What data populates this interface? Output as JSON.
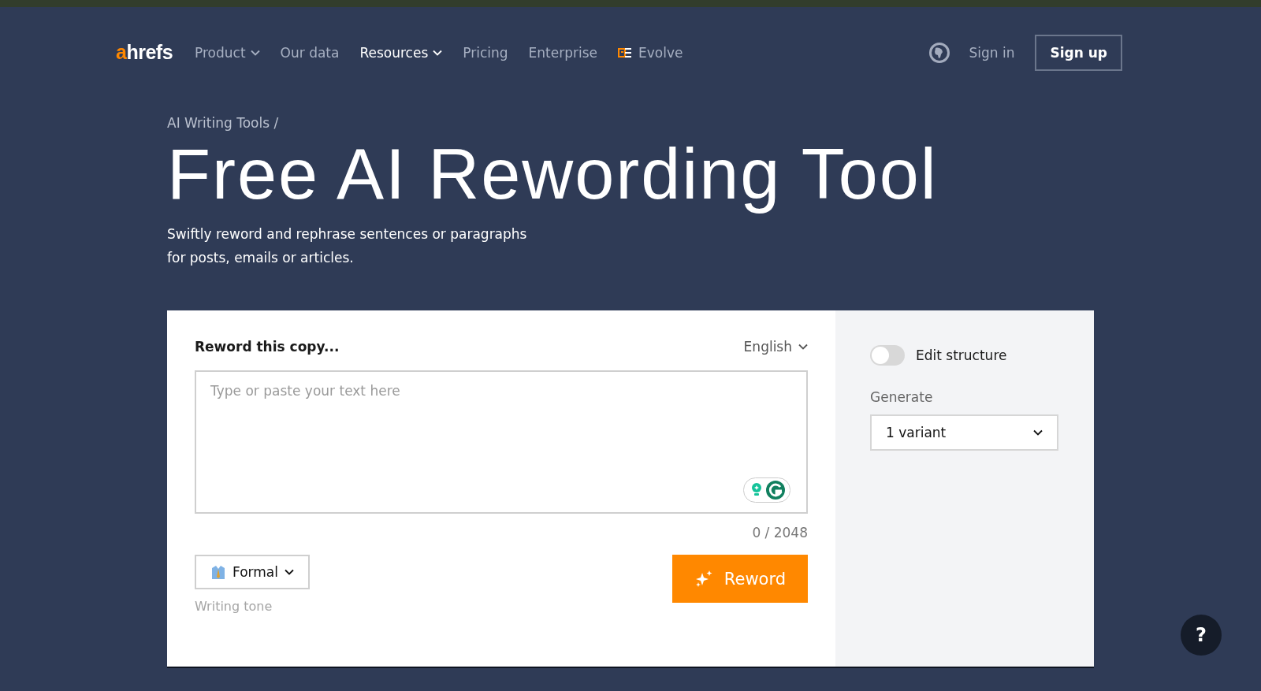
{
  "logo": {
    "accent": "a",
    "text": "hrefs"
  },
  "nav": [
    {
      "label": "Product",
      "has_menu": true,
      "selected": false,
      "kind": "plain"
    },
    {
      "label": "Our data",
      "has_menu": false,
      "selected": false,
      "kind": "plain"
    },
    {
      "label": "Resources",
      "has_menu": true,
      "selected": true,
      "kind": "plain"
    },
    {
      "label": "Pricing",
      "has_menu": false,
      "selected": false,
      "kind": "plain"
    },
    {
      "label": "Enterprise",
      "has_menu": false,
      "selected": false,
      "kind": "plain"
    },
    {
      "label": "Evolve",
      "has_menu": false,
      "selected": false,
      "kind": "brand"
    }
  ],
  "account": {
    "sign_in": "Sign in",
    "sign_up": "Sign up"
  },
  "breadcrumb": "AI Writing Tools /",
  "title": "Free AI Rewording Tool",
  "subtitle": [
    "Swiftly reword and rephrase sentences or paragraphs",
    "for posts, emails or articles."
  ],
  "editor": {
    "heading": "Reword this copy...",
    "language": "English",
    "placeholder": "Type or paste your text here",
    "counter": "0 / 2048",
    "tone": "Formal",
    "tone_label": "Writing tone",
    "action": "Reword"
  },
  "options": {
    "toggle": {
      "label": "Edit structure",
      "on": false
    },
    "generate_label": "Generate",
    "generate_value": "1 variant"
  },
  "help": "?"
}
